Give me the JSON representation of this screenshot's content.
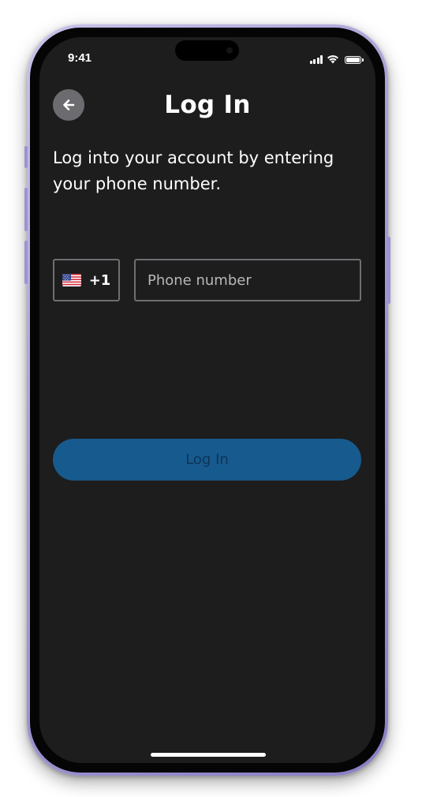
{
  "status_bar": {
    "time": "9:41",
    "signal_icon": "cellular-signal-icon",
    "wifi_icon": "wifi-icon",
    "battery_icon": "battery-icon"
  },
  "header": {
    "back_icon": "arrow-left-icon",
    "title": "Log In"
  },
  "subtitle": "Log into your account by entering your phone number.",
  "phone_form": {
    "country_flag_icon": "us-flag-icon",
    "country_code": "+1",
    "phone_placeholder": "Phone number",
    "phone_value": ""
  },
  "login_button": {
    "label": "Log In"
  },
  "colors": {
    "screen_background": "#1d1d1d",
    "button_background": "#175a8e",
    "button_text": "#0d3556",
    "input_border": "#6e6e73",
    "back_button_background": "#6c6c70",
    "phone_frame": "#a99fd6"
  }
}
